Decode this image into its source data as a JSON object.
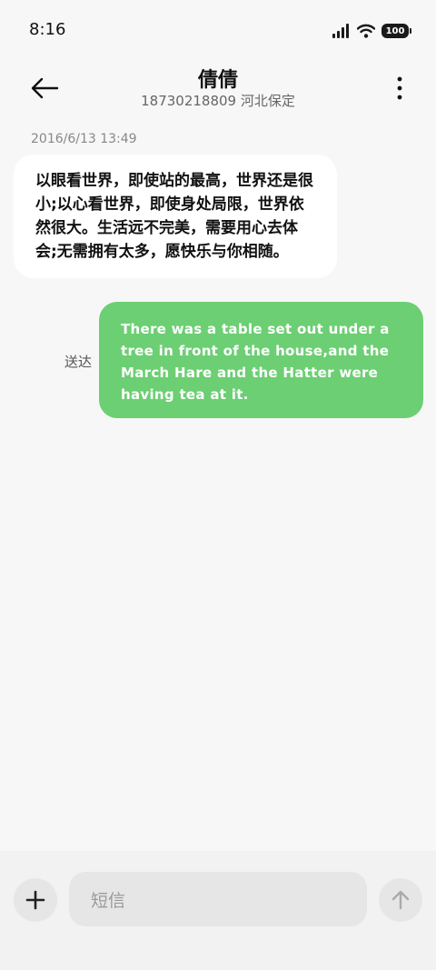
{
  "status_bar": {
    "time": "8:16",
    "battery": "100"
  },
  "header": {
    "contact_name": "倩倩",
    "contact_detail": "18730218809  河北保定"
  },
  "messages": [
    {
      "direction": "incoming",
      "timestamp": "2016/6/13  13:49",
      "text": "以眼看世界，即使站的最高，世界还是很小;以心看世界，即使身处局限，世界依然很大。生活远不完美，需要用心去体会;无需拥有太多，愿快乐与你相随。"
    },
    {
      "direction": "outgoing",
      "text": "There was a table set out under a tree in front of the house,and the March Hare and the Hatter were having tea at it.",
      "status": "送达"
    }
  ],
  "composer": {
    "placeholder": "短信"
  },
  "colors": {
    "outgoing_bubble": "#6ccf73",
    "incoming_bubble": "#ffffff",
    "background": "#f7f7f7"
  },
  "icons": {
    "back": "arrow-left-icon",
    "more": "more-vertical-icon",
    "add": "plus-icon",
    "send": "arrow-up-icon",
    "signal": "signal-icon",
    "wifi": "wifi-icon",
    "battery": "battery-icon"
  }
}
